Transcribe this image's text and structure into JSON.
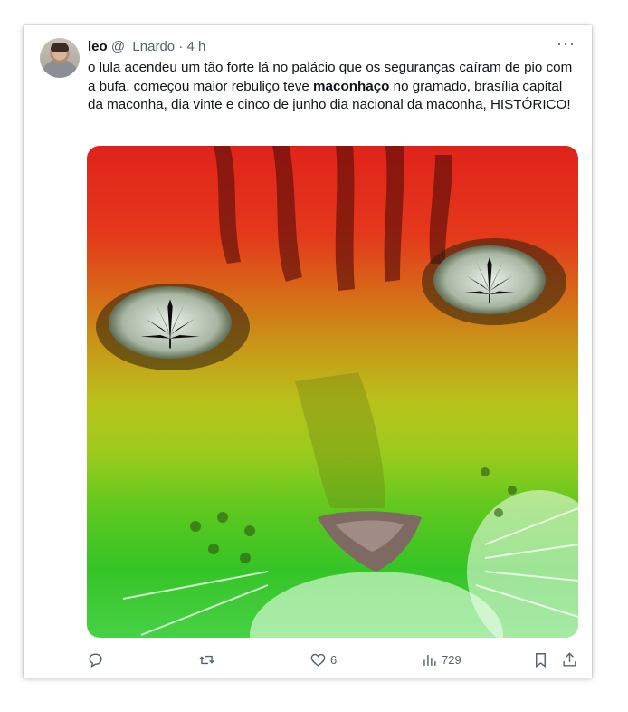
{
  "tweet": {
    "author_name": "leo",
    "handle": "@_Lnardo",
    "separator": "·",
    "time": "4 h",
    "more_label": "···",
    "text_before": "o lula acendeu um tão forte lá no palácio que os seguranças caíram de pio com a bufa, começou maior rebuliço teve ",
    "text_bold": "maconhaço",
    "text_after": " no gramado, brasília capital da maconha, dia vinte e cinco de junho dia nacional da maconha, HISTÓRICO!",
    "media_icon": "rasta-cat-with-cannabis-leaf-eyes-image"
  },
  "actions": {
    "reply": {
      "icon": "reply-icon",
      "count": ""
    },
    "retweet": {
      "icon": "retweet-icon",
      "count": ""
    },
    "like": {
      "icon": "heart-icon",
      "count": "6"
    },
    "views": {
      "icon": "views-icon",
      "count": "729"
    },
    "bookmark": {
      "icon": "bookmark-icon"
    },
    "share": {
      "icon": "share-icon"
    }
  },
  "colors": {
    "text": "#0f1419",
    "secondary": "#536471"
  }
}
